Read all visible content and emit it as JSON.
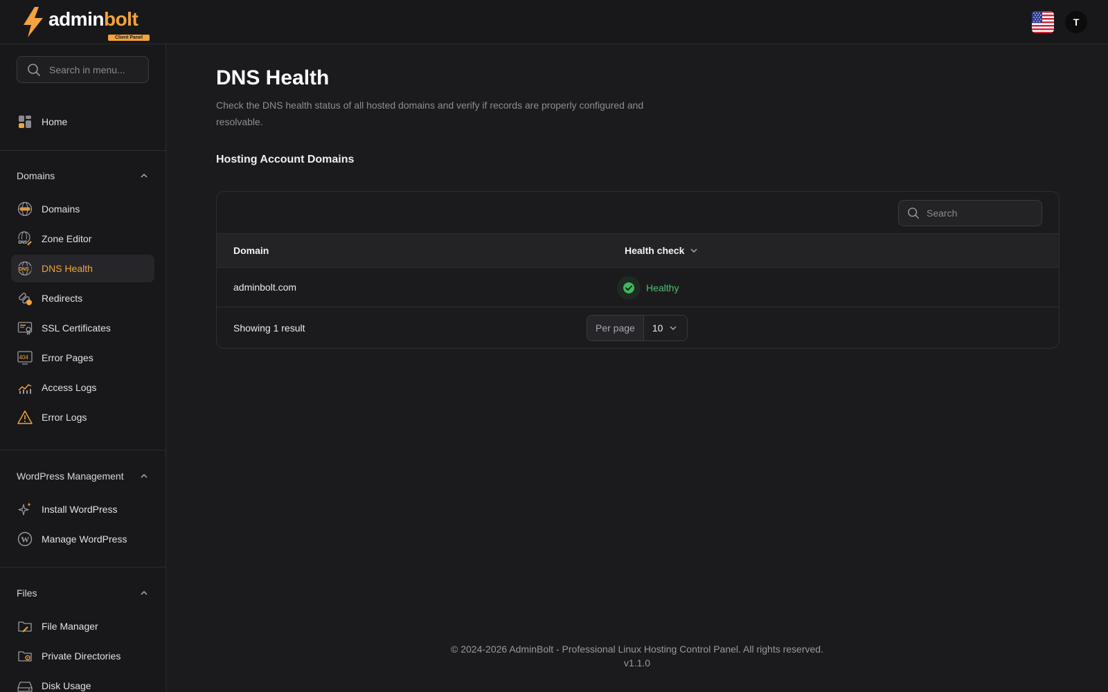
{
  "brand": {
    "name_part1": "admin",
    "name_part2": "bolt",
    "subtitle": "Client Panel",
    "accent_color": "#f3a43b"
  },
  "header": {
    "language_icon": "us-flag-icon",
    "avatar_initial": "T"
  },
  "sidebar": {
    "search_placeholder": "Search in menu...",
    "home": {
      "label": "Home",
      "icon": "home-grid-icon"
    },
    "groups": [
      {
        "title": "Domains",
        "expanded": true,
        "items": [
          {
            "label": "Domains",
            "icon": "globe-icon"
          },
          {
            "label": "Zone Editor",
            "icon": "dns-edit-icon"
          },
          {
            "label": "DNS Health",
            "icon": "dns-health-icon",
            "active": true
          },
          {
            "label": "Redirects",
            "icon": "link-icon"
          },
          {
            "label": "SSL Certificates",
            "icon": "certificate-icon"
          },
          {
            "label": "Error Pages",
            "icon": "error-404-icon"
          },
          {
            "label": "Access Logs",
            "icon": "chart-icon"
          },
          {
            "label": "Error Logs",
            "icon": "warning-icon"
          }
        ]
      },
      {
        "title": "WordPress Management",
        "expanded": true,
        "items": [
          {
            "label": "Install WordPress",
            "icon": "sparkle-icon"
          },
          {
            "label": "Manage WordPress",
            "icon": "wordpress-icon"
          }
        ]
      },
      {
        "title": "Files",
        "expanded": true,
        "items": [
          {
            "label": "File Manager",
            "icon": "folder-edit-icon"
          },
          {
            "label": "Private Directories",
            "icon": "folder-lock-icon"
          },
          {
            "label": "Disk Usage",
            "icon": "disk-icon"
          }
        ]
      }
    ]
  },
  "main": {
    "title": "DNS Health",
    "description": "Check the DNS health status of all hosted domains and verify if records are properly configured and resolvable.",
    "section_title": "Hosting Account Domains",
    "table": {
      "search_placeholder": "Search",
      "columns": [
        "Domain",
        "Health check"
      ],
      "rows": [
        {
          "domain": "adminbolt.com",
          "health": "Healthy",
          "status_color": "#4fc16d"
        }
      ],
      "showing_text": "Showing 1 result",
      "per_page_label": "Per page",
      "per_page_value": "10"
    }
  },
  "footer": {
    "copyright": "© 2024-2026 AdminBolt - Professional Linux Hosting Control Panel. All rights reserved.",
    "version": "v1.1.0"
  }
}
